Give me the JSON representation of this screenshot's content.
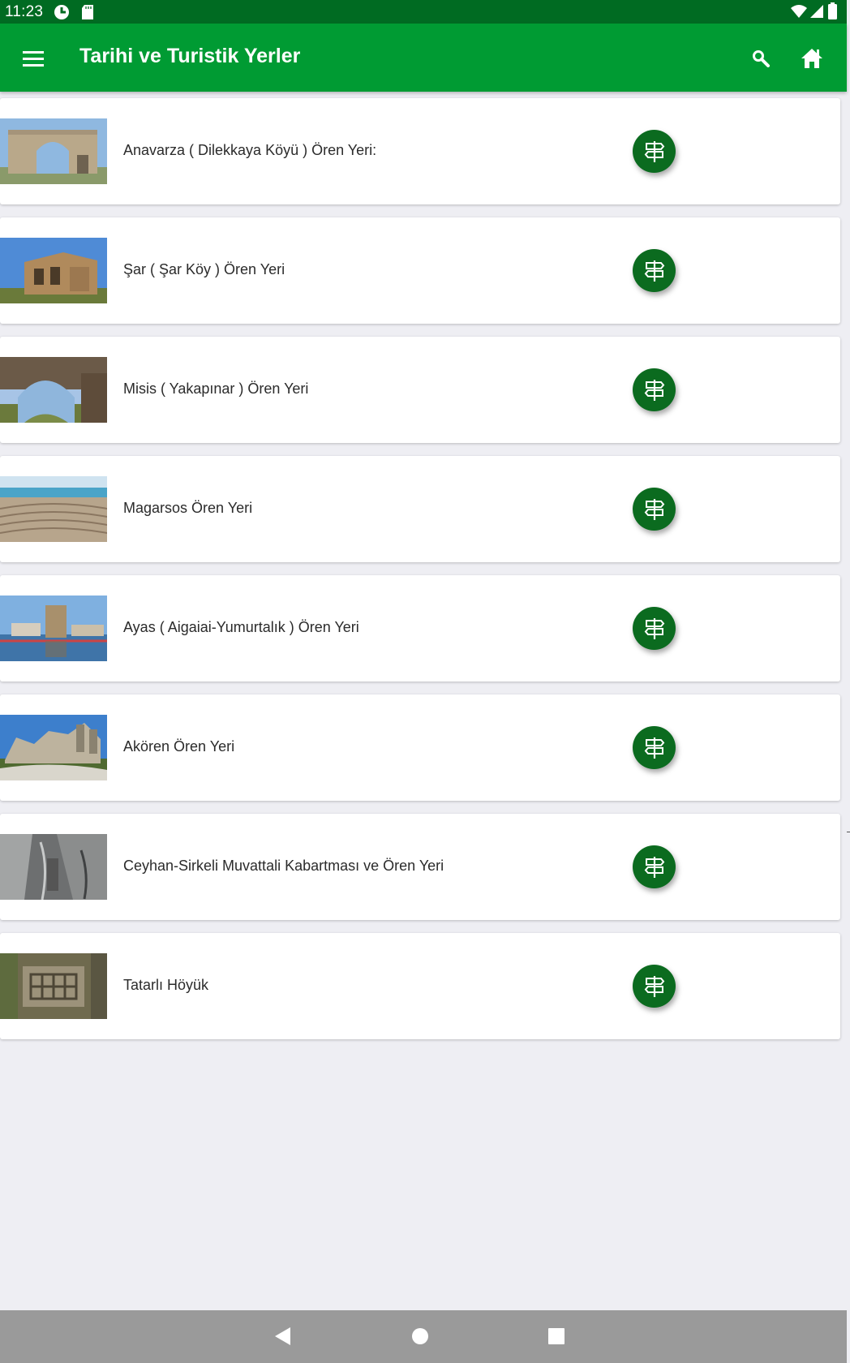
{
  "status_bar": {
    "time": "11:23",
    "icons": [
      "data-saver-icon",
      "sd-card-icon",
      "wifi-icon",
      "signal-icon",
      "battery-icon"
    ]
  },
  "app_bar": {
    "title": "Tarihi ve Turistik Yerler",
    "menu_icon": "hamburger-menu-icon",
    "search_icon": "search-icon",
    "home_icon": "home-icon"
  },
  "places": [
    {
      "name": "Anavarza ( Dilekkaya Köyü ) Ören Yeri:",
      "thumb": "arch-ruin"
    },
    {
      "name": "Şar ( Şar Köy ) Ören Yeri",
      "thumb": "temple-ruin"
    },
    {
      "name": "Misis ( Yakapınar ) Ören Yeri",
      "thumb": "stone-arch"
    },
    {
      "name": "Magarsos Ören Yeri",
      "thumb": "seaside-theatre"
    },
    {
      "name": "Ayas ( Aigaiai-Yumurtalık ) Ören Yeri",
      "thumb": "harbour-tower"
    },
    {
      "name": "Akören Ören Yeri",
      "thumb": "hill-ruins"
    },
    {
      "name": "Ceyhan-Sirkeli Muvattali Kabartması ve Ören Yeri",
      "thumb": "rock-relief"
    },
    {
      "name": "Tatarlı Höyük",
      "thumb": "excavation-site"
    }
  ],
  "direction_icon": "signpost-icon",
  "nav_bar": {
    "back_icon": "back-triangle-icon",
    "home_icon": "home-circle-icon",
    "recents_icon": "recents-square-icon"
  },
  "colors": {
    "status_bar": "#006b22",
    "app_bar": "#009b33",
    "fab": "#0b6b1f",
    "background": "#eeeef3",
    "nav_bar": "#9a9a9a"
  }
}
